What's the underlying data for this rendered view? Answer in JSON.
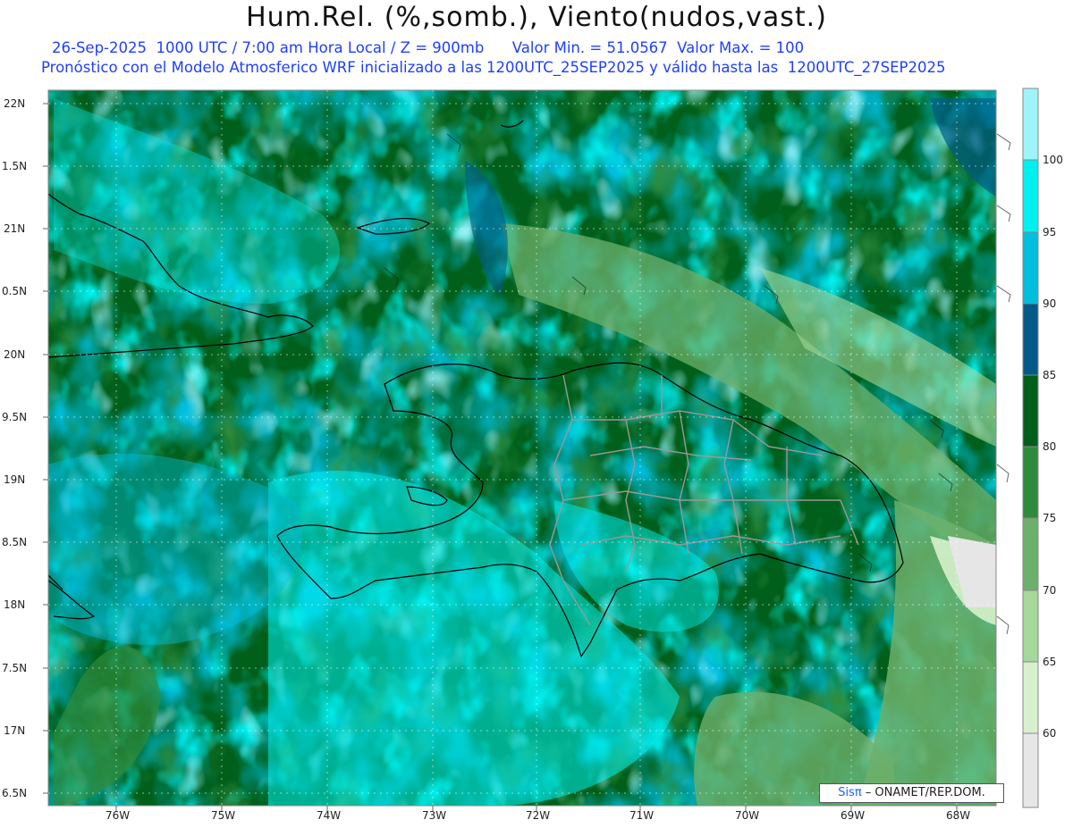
{
  "header": {
    "title": "Hum.Rel. (%,somb.), Viento(nudos,vast.)",
    "subtitle_line1": "26-Sep-2025  1000 UTC / 7:00 am Hora Local / Z = 900mb      Valor Min. = 51.0567  Valor Max. = 100",
    "subtitle_line2": "Pronóstico con el Modelo Atmosferico WRF inicializado a las 1200UTC_25SEP2025 y válido hasta las  1200UTC_27SEP2025"
  },
  "axes": {
    "y_labels": [
      "22N",
      "1.5N",
      "21N",
      "0.5N",
      "20N",
      "9.5N",
      "19N",
      "8.5N",
      "18N",
      "7.5N",
      "17N",
      "6.5N"
    ],
    "x_labels": [
      "76W",
      "75W",
      "74W",
      "73W",
      "72W",
      "71W",
      "70W",
      "69W",
      "68W"
    ]
  },
  "colorbar": {
    "labels": [
      "100",
      "95",
      "90",
      "85",
      "80",
      "75",
      "70",
      "65",
      "60"
    ],
    "colors": [
      "#9ff4fa",
      "#00f0f0",
      "#00bedd",
      "#005b88",
      "#005f1a",
      "#2f8b3c",
      "#6db06b",
      "#a5d89a",
      "#d6f1cc",
      "#e6e6e6"
    ]
  },
  "credit": {
    "brand": "Sisπ",
    "text": " – ONAMET/REP.DOM."
  },
  "chart_data": {
    "type": "heatmap",
    "variable": "Hum.Rel. (%,somb.), Viento(nudos,vast.)",
    "value_min": 51.0567,
    "value_max": 100,
    "levels": [
      60,
      65,
      70,
      75,
      80,
      85,
      90,
      95,
      100
    ],
    "lat_range": [
      16.4,
      22.1
    ],
    "lon_range": [
      -76.6,
      -67.6
    ]
  }
}
